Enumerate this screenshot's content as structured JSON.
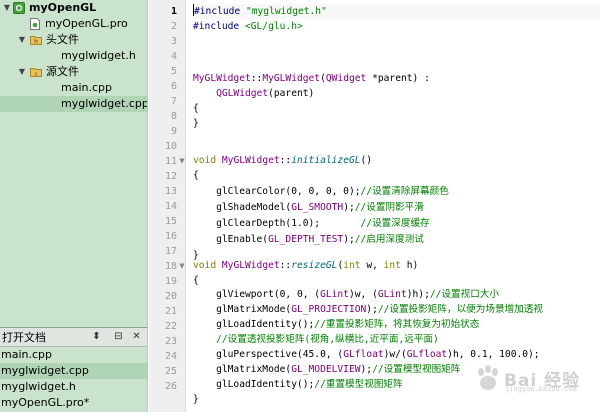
{
  "project_tree": {
    "items": [
      {
        "label": "myOpenGL",
        "bold": true
      },
      {
        "label": "myOpenGL.pro"
      },
      {
        "label": "头文件"
      },
      {
        "label": "myglwidget.h"
      },
      {
        "label": "源文件"
      },
      {
        "label": "main.cpp"
      },
      {
        "label": "myglwidget.cpp"
      }
    ]
  },
  "open_documents": {
    "title": "打开文档",
    "docs": [
      "main.cpp",
      "myglwidget.cpp",
      "myglwidget.h",
      "myOpenGL.pro*"
    ]
  },
  "editor": {
    "line_numbers": [
      "1",
      "2",
      "3",
      "4",
      "5",
      "6",
      "7",
      "8",
      "9",
      "10",
      "11",
      "12",
      "13",
      "14",
      "15",
      "16",
      "17",
      "18",
      "19",
      "20",
      "21",
      "22",
      "23",
      "24",
      "25",
      "26"
    ],
    "code": {
      "l1_a": "#include ",
      "l1_b": "\"myglwidget.h\"",
      "l2_a": "#include ",
      "l2_b": "<GL/glu.h>",
      "l6_a": "MyGLWidget",
      "l6_b": "::",
      "l6_c": "MyGLWidget",
      "l6_d": "(",
      "l6_e": "QWidget",
      "l6_f": " *parent) :",
      "l7_a": "    ",
      "l7_b": "QGLWidget",
      "l7_c": "(parent)",
      "brace_open": "{",
      "brace_close": "}",
      "l11_a": "void ",
      "l11_b": "MyGLWidget",
      "l11_c": "::",
      "l11_d": "initializeGL",
      "l11_e": "()",
      "l13_a": "    glClearColor(0, 0, 0, 0);",
      "l13_b": "//设置清除屏幕颜色",
      "l14_a": "    glShadeModel(",
      "l14_b": "GL_SMOOTH",
      "l14_c": ");",
      "l14_d": "//设置阴影平滑",
      "l15_a": "    glClearDepth(1.0);       ",
      "l15_b": "//设置深度缓存",
      "l16_a": "    glEnable(",
      "l16_b": "GL_DEPTH_TEST",
      "l16_c": ");",
      "l16_d": "//启用深度测试",
      "l19_a": "void ",
      "l19_b": "MyGLWidget",
      "l19_c": "::",
      "l19_d": "resizeGL",
      "l19_e": "(",
      "l19_f": "int",
      "l19_g": " w, ",
      "l19_h": "int",
      "l19_i": " h)",
      "l21_a": "    glViewport(0, 0, (",
      "l21_b": "GLint",
      "l21_c": ")w, (",
      "l21_d": "GLint",
      "l21_e": ")h);",
      "l21_f": "//设置视口大小",
      "l22_a": "    glMatrixMode(",
      "l22_b": "GL_PROJECTION",
      "l22_c": ");",
      "l22_d": "//设置投影矩阵，以便为场景增加透视",
      "l23_a": "    glLoadIdentity();",
      "l23_b": "//重置投影矩阵，将其恢复为初始状态",
      "l24_a": "    ",
      "l24_b": "//设置透视投影矩阵(视角,纵横比,近平面,远平面)",
      "l25_a": "    gluPerspective(45.0, (",
      "l25_b": "GLfloat",
      "l25_c": ")w/(",
      "l25_d": "GLfloat",
      "l25_e": ")h, 0.1, 100.0);",
      "l26_a": "    glMatrixMode(",
      "l26_b": "GL_MODELVIEW",
      "l26_c": ");",
      "l26_d": "//设置模型视图矩阵",
      "l27_a": "    glLoadIdentity();",
      "l27_b": "//重置模型视图矩阵"
    }
  },
  "watermark": {
    "text": "Bai 经验",
    "sub": "jingyan.baidu.com"
  },
  "colors": {
    "sidebar_bg": "#c9e3cc",
    "preprocessor": "#000080",
    "string": "#008000",
    "class": "#800080",
    "keyword": "#808000",
    "function": "#00677c",
    "comment": "#008000"
  }
}
